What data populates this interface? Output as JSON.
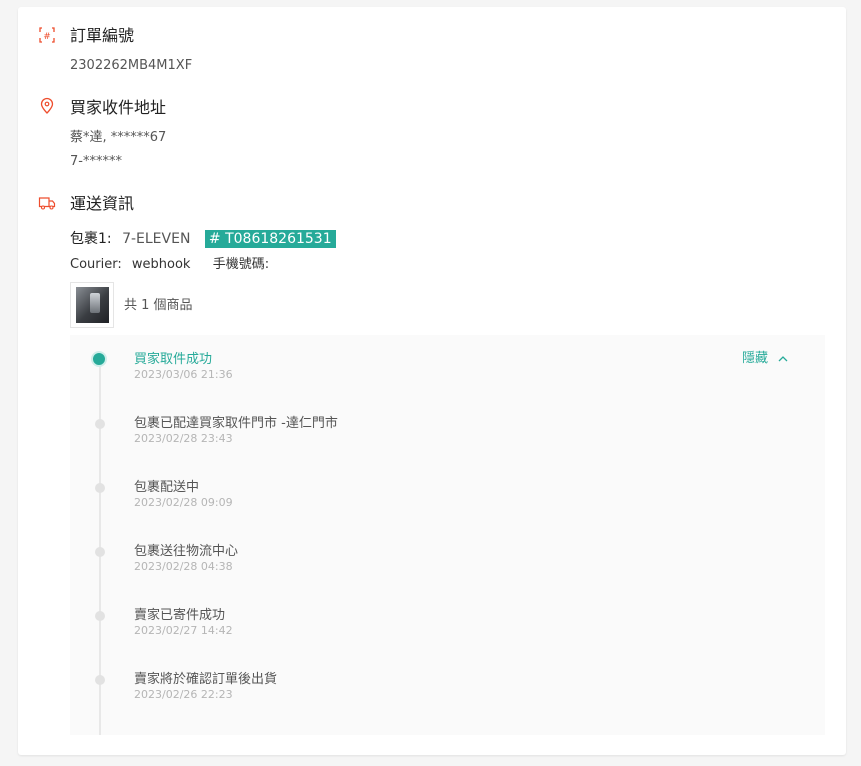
{
  "order": {
    "heading": "訂單編號",
    "number": "2302262MB4M1XF"
  },
  "address": {
    "heading": "買家收件地址",
    "line1": "蔡*達, ******67",
    "line2": "7-******"
  },
  "shipping": {
    "heading": "運送資訊",
    "package_label": "包裹1:",
    "carrier": "7-ELEVEN",
    "tracking_number": "# T08618261531",
    "courier_label": "Courier:",
    "courier_value": "webhook",
    "phone_label": "手機號碼:",
    "items_count": "共 1 個商品"
  },
  "timeline": {
    "toggle_label": "隱藏",
    "toggle_chevron": "^",
    "events": [
      {
        "title": "買家取件成功",
        "time": "2023/03/06 21:36",
        "active": true
      },
      {
        "title": "包裹已配達買家取件門市 -達仁門市",
        "time": "2023/02/28 23:43",
        "active": false
      },
      {
        "title": "包裹配送中",
        "time": "2023/02/28 09:09",
        "active": false
      },
      {
        "title": "包裹送往物流中心",
        "time": "2023/02/28 04:38",
        "active": false
      },
      {
        "title": "賣家已寄件成功",
        "time": "2023/02/27 14:42",
        "active": false
      },
      {
        "title": "賣家將於確認訂單後出貨",
        "time": "2023/02/26 22:23",
        "active": false
      }
    ]
  },
  "colors": {
    "accent": "#26aa99",
    "icon": "#ee4d2d"
  }
}
